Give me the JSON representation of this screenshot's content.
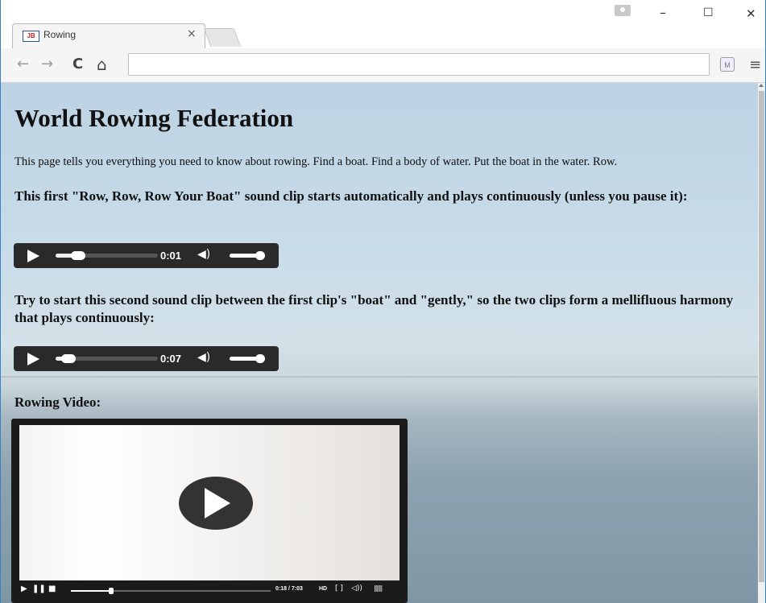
{
  "browser": {
    "tab_title": "Rowing",
    "favicon_text": "JB",
    "tab_close": "×",
    "minimize": "–",
    "maximize": "☐",
    "close": "✕",
    "address": "",
    "back_icon": "←",
    "forward_icon": "→",
    "reload_icon": "C",
    "home_icon": "⌂",
    "extension_icon_text": "M",
    "menu_icon": "≡"
  },
  "page": {
    "title": "World Rowing Federation",
    "intro": "This page tells you everything you need to know about rowing. Find a boat. Find a body of water. Put the boat in the water. Row.",
    "clip1_heading": "This first \"Row, Row, Row Your Boat\" sound clip starts automatically and plays continuously (unless you pause it):",
    "clip2_heading": "Try to start this second sound clip between the first clip's \"boat\" and \"gently,\" so the two clips form a mellifluous harmony that plays continuously:",
    "video_label": "Rowing Video:"
  },
  "audio_players": [
    {
      "time": "0:01",
      "progress": 0.2,
      "volume": 1.0
    },
    {
      "time": "0:07",
      "progress": 0.1,
      "volume": 1.0
    }
  ],
  "video_player": {
    "time": "0:18 / 7:03",
    "hd_label": "HD",
    "progress": 0.2
  }
}
